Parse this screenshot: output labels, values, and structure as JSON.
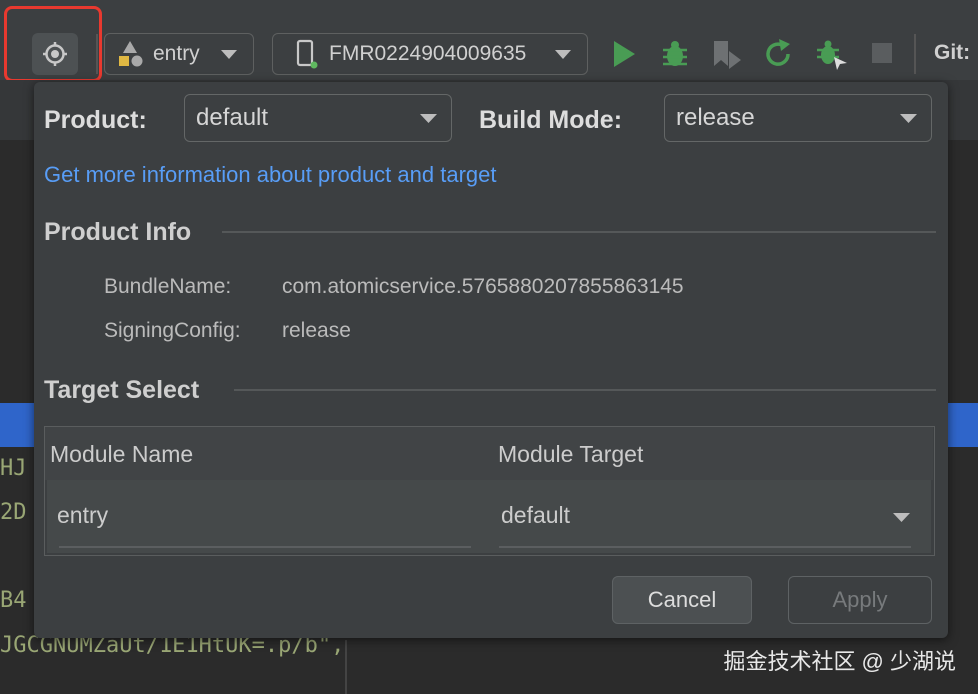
{
  "toolbar": {
    "module_combo": "entry",
    "device_combo": "FMR0224904009635",
    "git_label": "Git:",
    "icons": [
      "target-icon",
      "module-shapes-icon",
      "phone-icon",
      "run-icon",
      "debug-icon",
      "attach-icon",
      "rerun-icon",
      "debug-attach-icon",
      "stop-icon"
    ],
    "colors": {
      "run": "#499c54",
      "highlight": "#e8392f"
    }
  },
  "editor": {
    "fragments": [
      "HJ",
      "2D",
      "B4",
      "JGCGNUMZaUt/1E1HtUK=.p/b\","
    ]
  },
  "popup": {
    "product_label": "Product:",
    "product_value": "default",
    "build_mode_label": "Build Mode:",
    "build_mode_value": "release",
    "info_link": "Get more information about product and target",
    "product_info_title": "Product Info",
    "bundle_name_key": "BundleName:",
    "bundle_name_value": "com.atomicservice.5765880207855863145",
    "signing_config_key": "SigningConfig:",
    "signing_config_value": "release",
    "target_select_title": "Target Select",
    "table": {
      "columns": [
        "Module Name",
        "Module Target"
      ],
      "rows": [
        {
          "module_name": "entry",
          "module_target": "default"
        }
      ]
    },
    "cancel_label": "Cancel",
    "apply_label": "Apply",
    "link_color": "#589df6"
  },
  "watermark": "掘金技术社区 @ 少湖说"
}
